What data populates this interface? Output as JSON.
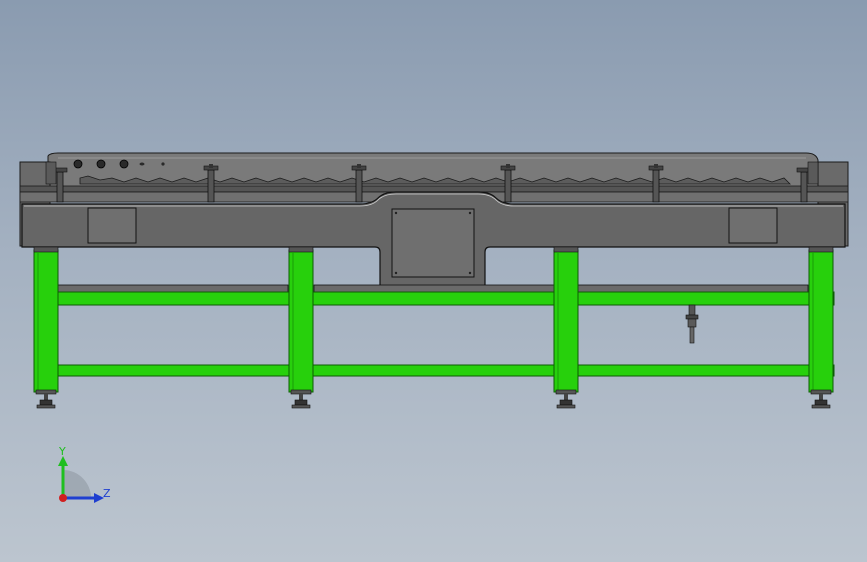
{
  "colors": {
    "background_top": "#8a9bb0",
    "background_bottom": "#bcc5cf",
    "frame_green": "#27d00c",
    "frame_green_dark": "#139a05",
    "conveyor_grey": "#6e6e6e",
    "conveyor_dark": "#404040",
    "outline": "#1a1a1a",
    "axis_y": "#1fbf1f",
    "axis_z": "#1f3fd0",
    "axis_x": "#d01f1f"
  },
  "icons": {
    "triad": "coordinate-triad-icon"
  },
  "triad": {
    "y_label": "Y",
    "z_label": "Z"
  }
}
